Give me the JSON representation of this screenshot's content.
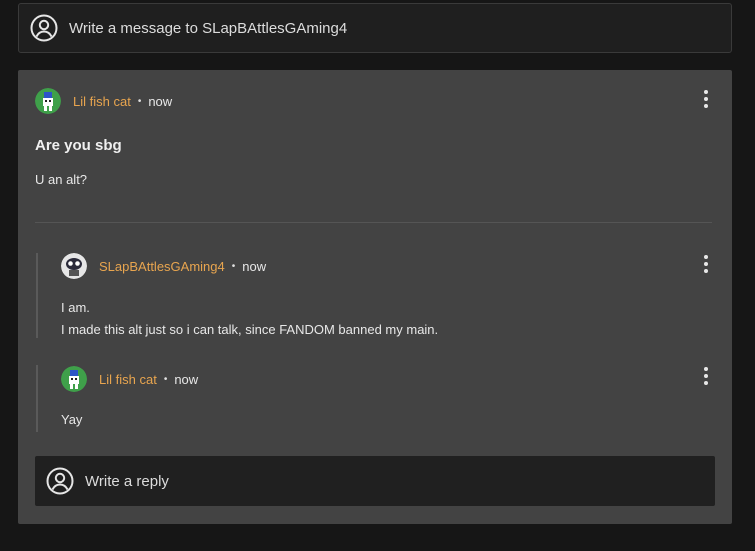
{
  "compose": {
    "placeholder": "Write a message to SLapBAttlesGAming4"
  },
  "post": {
    "author": "Lil fish cat",
    "time": "now",
    "title": "Are you sbg",
    "body": "U an alt?"
  },
  "replies": [
    {
      "author": "SLapBAttlesGAming4",
      "time": "now",
      "lines": [
        "I am.",
        "I made this alt just so i can talk, since FANDOM banned my main."
      ]
    },
    {
      "author": "Lil fish cat",
      "time": "now",
      "lines": [
        "Yay"
      ]
    }
  ],
  "reply_compose": {
    "placeholder": "Write a reply"
  },
  "separator": "•",
  "colors": {
    "accent": "#e8a54f",
    "panel": "#434343",
    "background": "#161616"
  }
}
